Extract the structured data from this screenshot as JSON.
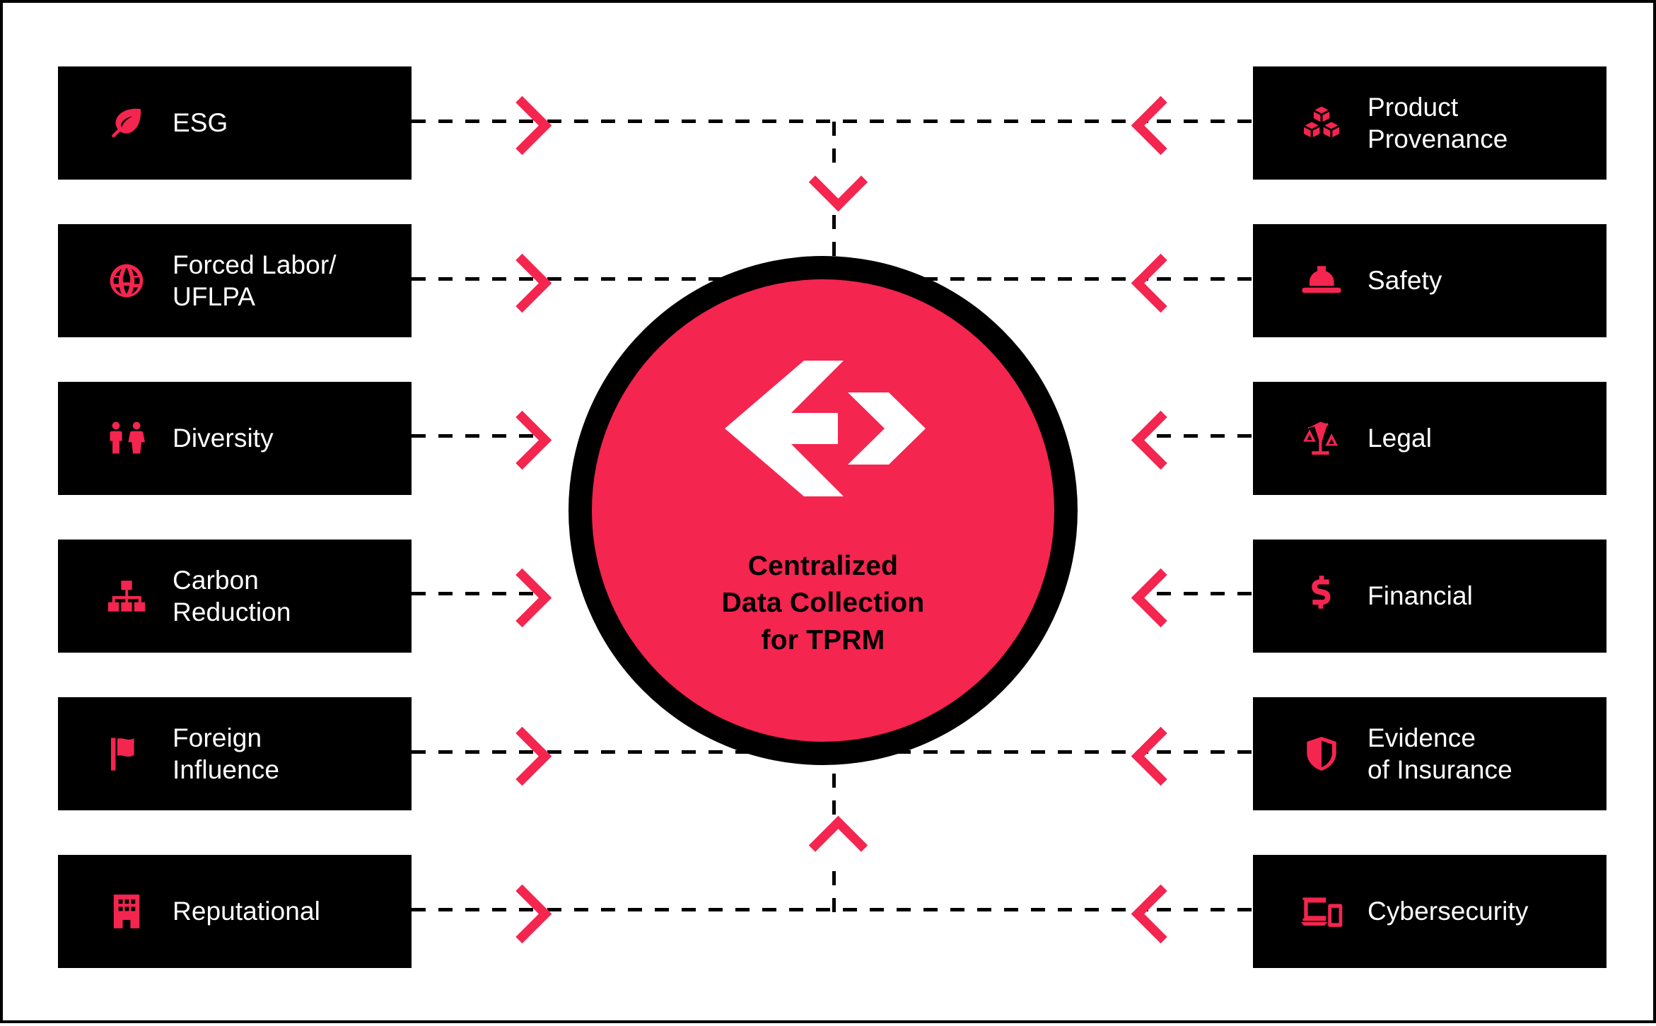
{
  "colors": {
    "accent": "#F4254F",
    "box_background": "#000000",
    "box_text": "#FFFFFF",
    "page_background": "#FFFFFF",
    "connector": "#000000"
  },
  "center": {
    "logo_icon": "double-chevron-logo-icon",
    "title": "Centralized\nData Collection\nfor TPRM"
  },
  "left_column": [
    {
      "label": "ESG",
      "icon": "leaf-icon"
    },
    {
      "label": "Forced Labor/\nUFLPA",
      "icon": "globe-icon"
    },
    {
      "label": "Diversity",
      "icon": "two-people-icon"
    },
    {
      "label": "Carbon\nReduction",
      "icon": "hierarchy-icon"
    },
    {
      "label": "Foreign\nInfluence",
      "icon": "flag-icon"
    },
    {
      "label": "Reputational",
      "icon": "building-icon"
    }
  ],
  "right_column": [
    {
      "label": "Product\nProvenance",
      "icon": "boxes-cubes-icon"
    },
    {
      "label": "Safety",
      "icon": "hard-hat-icon"
    },
    {
      "label": "Legal",
      "icon": "scales-icon"
    },
    {
      "label": "Financial",
      "icon": "dollar-sign-icon"
    },
    {
      "label": "Evidence\nof Insurance",
      "icon": "shield-icon"
    },
    {
      "label": "Cybersecurity",
      "icon": "devices-icon"
    }
  ],
  "connectors": {
    "left_arrow_icon": "chevron-right-icon",
    "right_arrow_icon": "chevron-left-icon",
    "top_arrow_icon": "chevron-down-icon",
    "bottom_arrow_icon": "chevron-up-icon"
  }
}
